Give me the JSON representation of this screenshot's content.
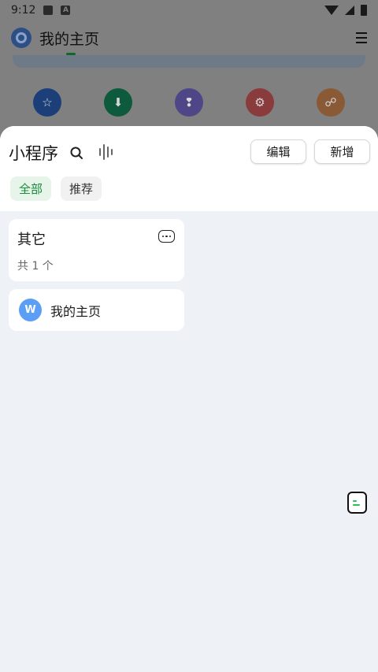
{
  "status_bar": {
    "time": "9:12",
    "icon_a": "A"
  },
  "app": {
    "title": "我的主页"
  },
  "shortcuts": [
    {
      "icon": "star-icon",
      "glyph": "☆",
      "color": "#1d3f79"
    },
    {
      "icon": "download-icon",
      "glyph": "⬇",
      "color": "#0e5a3c"
    },
    {
      "icon": "footprint-icon",
      "glyph": "❢",
      "color": "#4d4787"
    },
    {
      "icon": "gear-icon",
      "glyph": "⚙",
      "color": "#8a3b3b"
    },
    {
      "icon": "share-icon",
      "glyph": "☍",
      "color": "#8a5a36"
    }
  ],
  "sheet": {
    "title": "小程序",
    "edit_label": "编辑",
    "add_label": "新增",
    "tabs": [
      {
        "label": "全部",
        "active": true
      },
      {
        "label": "推荐",
        "active": false
      }
    ],
    "group": {
      "name": "其它",
      "count": "共 1 个"
    },
    "item": {
      "label": "我的主页",
      "icon_letter": "W"
    }
  },
  "colors": {
    "accent": "#1b8a3a",
    "sheet_bg": "#eef1f5",
    "item_icon": "#5b9ef6"
  }
}
